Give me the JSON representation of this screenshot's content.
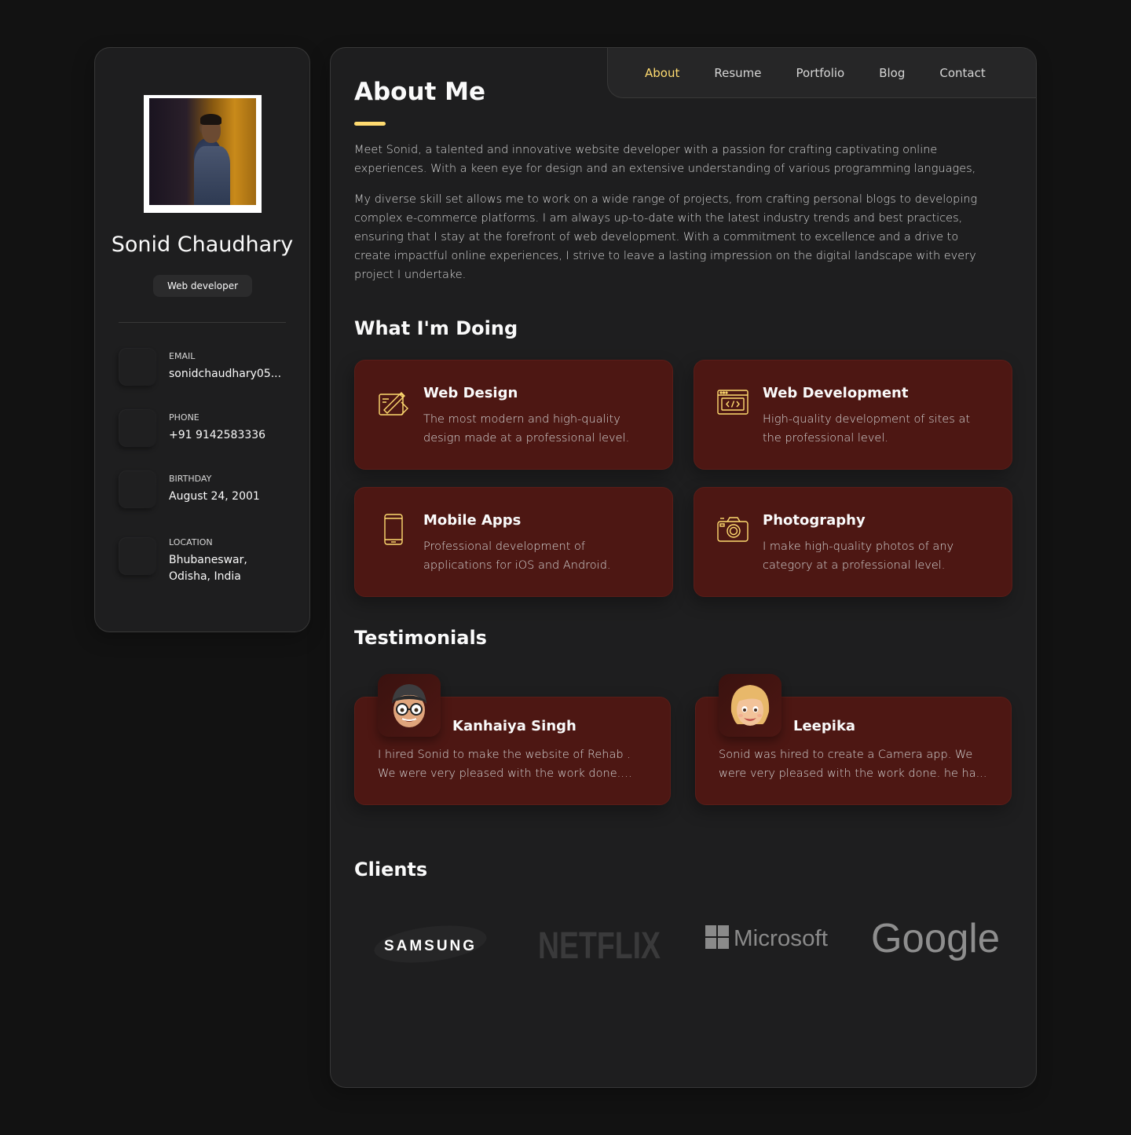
{
  "profile": {
    "name": "Sonid Chaudhary",
    "title": "Web developer",
    "contacts": [
      {
        "label": "Email",
        "value": "sonidchaudhary05..."
      },
      {
        "label": "Phone",
        "value": "+91 9142583336"
      },
      {
        "label": "Birthday",
        "value": "August 24, 2001"
      },
      {
        "label": "Location",
        "value": "Bhubaneswar, Odisha, India"
      }
    ]
  },
  "nav": {
    "items": [
      "About",
      "Resume",
      "Portfolio",
      "Blog",
      "Contact"
    ],
    "active": "About"
  },
  "about": {
    "heading": "About Me",
    "paragraphs": [
      "Meet Sonid, a talented and innovative website developer with a passion for crafting captivating online experiences. With a keen eye for design and an extensive understanding of various programming languages,",
      "My diverse skill set allows me to work on a wide range of projects, from crafting personal blogs to developing complex e-commerce platforms. I am always up-to-date with the latest industry trends and best practices, ensuring that I stay at the forefront of web development. With a commitment to excellence and a drive to create impactful online experiences, I strive to leave a lasting impression on the digital landscape with every project I undertake."
    ]
  },
  "services": {
    "heading": "What I'm Doing",
    "items": [
      {
        "title": "Web Design",
        "text": "The most modern and high-quality design made at a professional level.",
        "icon": "design-icon"
      },
      {
        "title": "Web Development",
        "text": "High-quality development of sites at the professional level.",
        "icon": "code-icon"
      },
      {
        "title": "Mobile Apps",
        "text": "Professional development of applications for iOS and Android.",
        "icon": "mobile-icon"
      },
      {
        "title": "Photography",
        "text": "I make high-quality photos of any category at a professional level.",
        "icon": "camera-icon"
      }
    ]
  },
  "testimonials": {
    "heading": "Testimonials",
    "items": [
      {
        "name": "Kanhaiya Singh",
        "text": "I hired Sonid to make the website of Rehab . We were very pleased with the work done. he..."
      },
      {
        "name": "Leepika",
        "text": "Sonid was hired to create a Camera app. We were very pleased with the work done. he ha..."
      }
    ]
  },
  "clients": {
    "heading": "Clients",
    "logos": [
      "SAMSUNG",
      "NETFLIX",
      "Microsoft",
      "Google"
    ]
  },
  "colors": {
    "accent": "#ffdb70",
    "card": "#4d1713",
    "background": "#121212",
    "panel": "#1e1e1f"
  }
}
